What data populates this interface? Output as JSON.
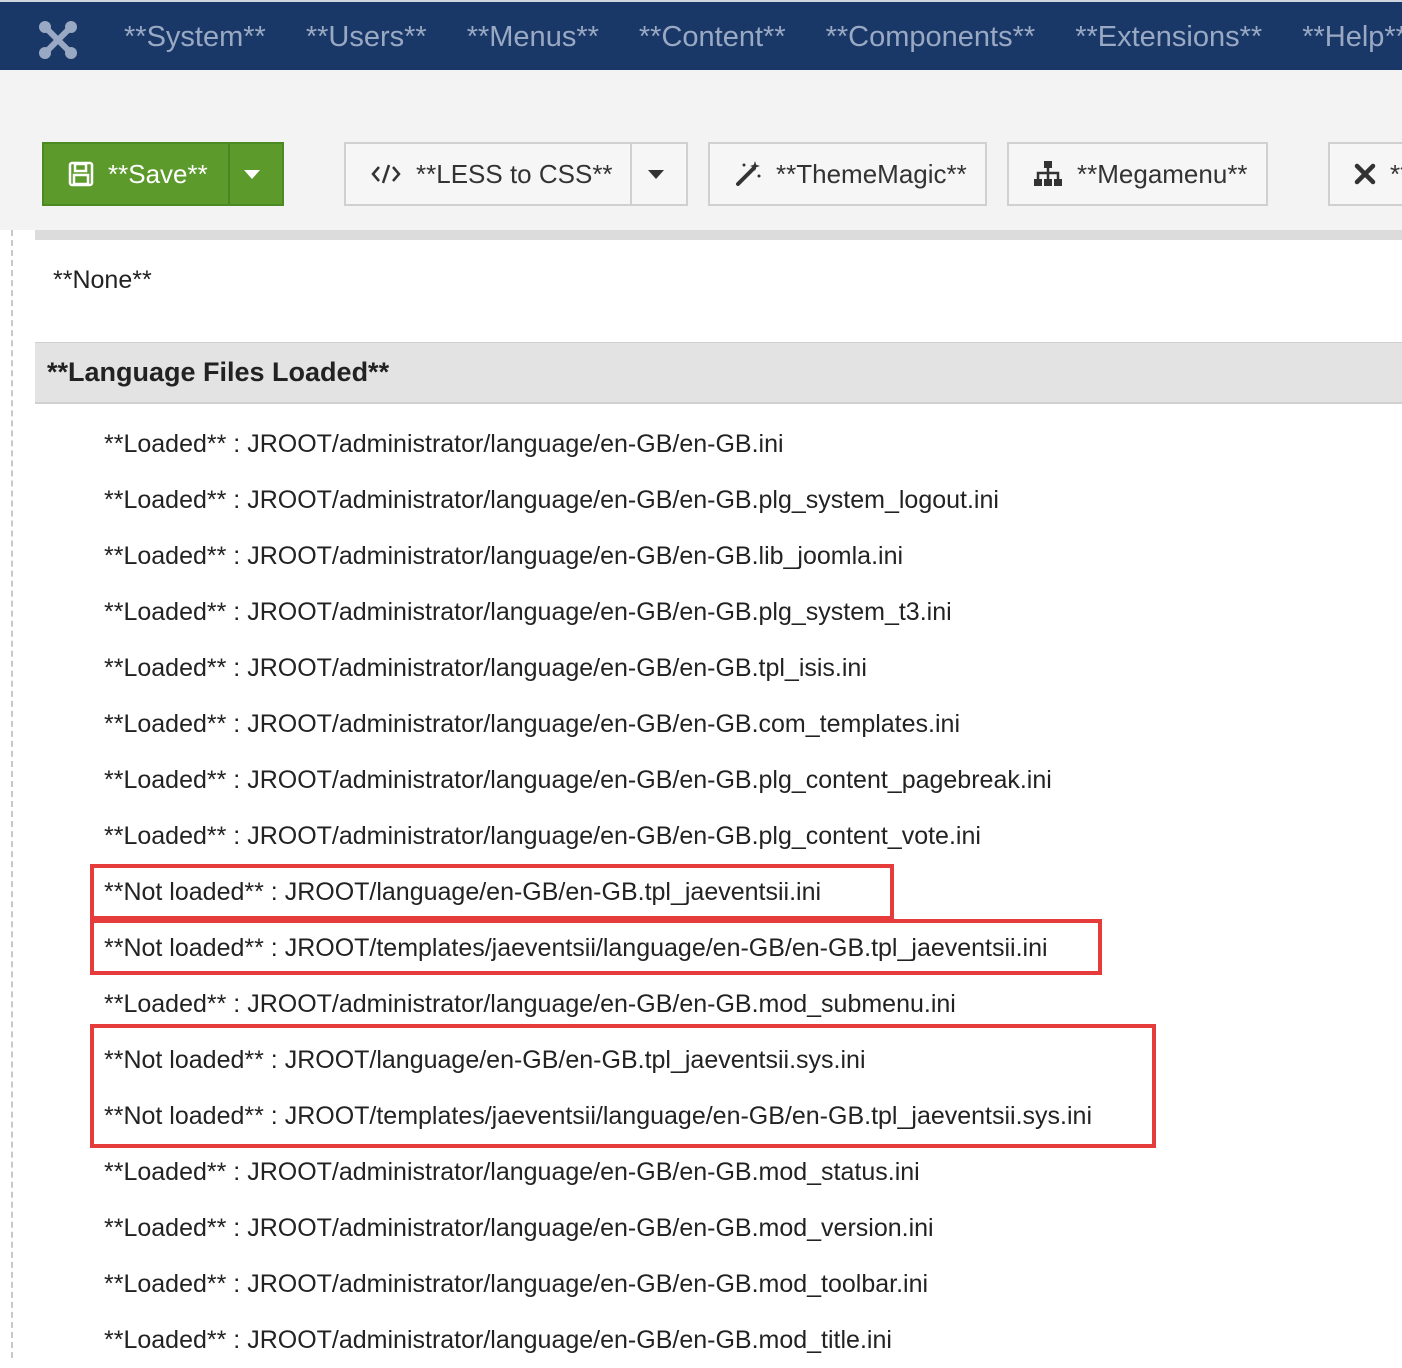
{
  "nav": {
    "logo": "joomla-logo",
    "items": [
      "**System**",
      "**Users**",
      "**Menus**",
      "**Content**",
      "**Components**",
      "**Extensions**",
      "**Help**"
    ]
  },
  "toolbar": {
    "save_label": "**Save**",
    "less_label": "**LESS to CSS**",
    "theme_label": "**ThemeMagic**",
    "mega_label": "**Megamenu**",
    "close_label": "**"
  },
  "content": {
    "none_text": "**None**",
    "section_title": "**Language Files Loaded**",
    "files": [
      {
        "status": "**Loaded**",
        "path": "JROOT/administrator/language/en-GB/en-GB.ini"
      },
      {
        "status": "**Loaded**",
        "path": "JROOT/administrator/language/en-GB/en-GB.plg_system_logout.ini"
      },
      {
        "status": "**Loaded**",
        "path": "JROOT/administrator/language/en-GB/en-GB.lib_joomla.ini"
      },
      {
        "status": "**Loaded**",
        "path": "JROOT/administrator/language/en-GB/en-GB.plg_system_t3.ini"
      },
      {
        "status": "**Loaded**",
        "path": "JROOT/administrator/language/en-GB/en-GB.tpl_isis.ini"
      },
      {
        "status": "**Loaded**",
        "path": "JROOT/administrator/language/en-GB/en-GB.com_templates.ini"
      },
      {
        "status": "**Loaded**",
        "path": "JROOT/administrator/language/en-GB/en-GB.plg_content_pagebreak.ini"
      },
      {
        "status": "**Loaded**",
        "path": "JROOT/administrator/language/en-GB/en-GB.plg_content_vote.ini"
      },
      {
        "status": "**Not loaded**",
        "path": "JROOT/language/en-GB/en-GB.tpl_jaeventsii.ini"
      },
      {
        "status": "**Not loaded**",
        "path": "JROOT/templates/jaeventsii/language/en-GB/en-GB.tpl_jaeventsii.ini"
      },
      {
        "status": "**Loaded**",
        "path": "JROOT/administrator/language/en-GB/en-GB.mod_submenu.ini"
      },
      {
        "status": "**Not loaded**",
        "path": "JROOT/language/en-GB/en-GB.tpl_jaeventsii.sys.ini"
      },
      {
        "status": "**Not loaded**",
        "path": "JROOT/templates/jaeventsii/language/en-GB/en-GB.tpl_jaeventsii.sys.ini"
      },
      {
        "status": "**Loaded**",
        "path": "JROOT/administrator/language/en-GB/en-GB.mod_status.ini"
      },
      {
        "status": "**Loaded**",
        "path": "JROOT/administrator/language/en-GB/en-GB.mod_version.ini"
      },
      {
        "status": "**Loaded**",
        "path": "JROOT/administrator/language/en-GB/en-GB.mod_toolbar.ini"
      },
      {
        "status": "**Loaded**",
        "path": "JROOT/administrator/language/en-GB/en-GB.mod_title.ini"
      }
    ]
  },
  "colors": {
    "nav_bg": "#1a3867",
    "save_green": "#5b9a2b",
    "highlight_red": "#e53b3b"
  }
}
